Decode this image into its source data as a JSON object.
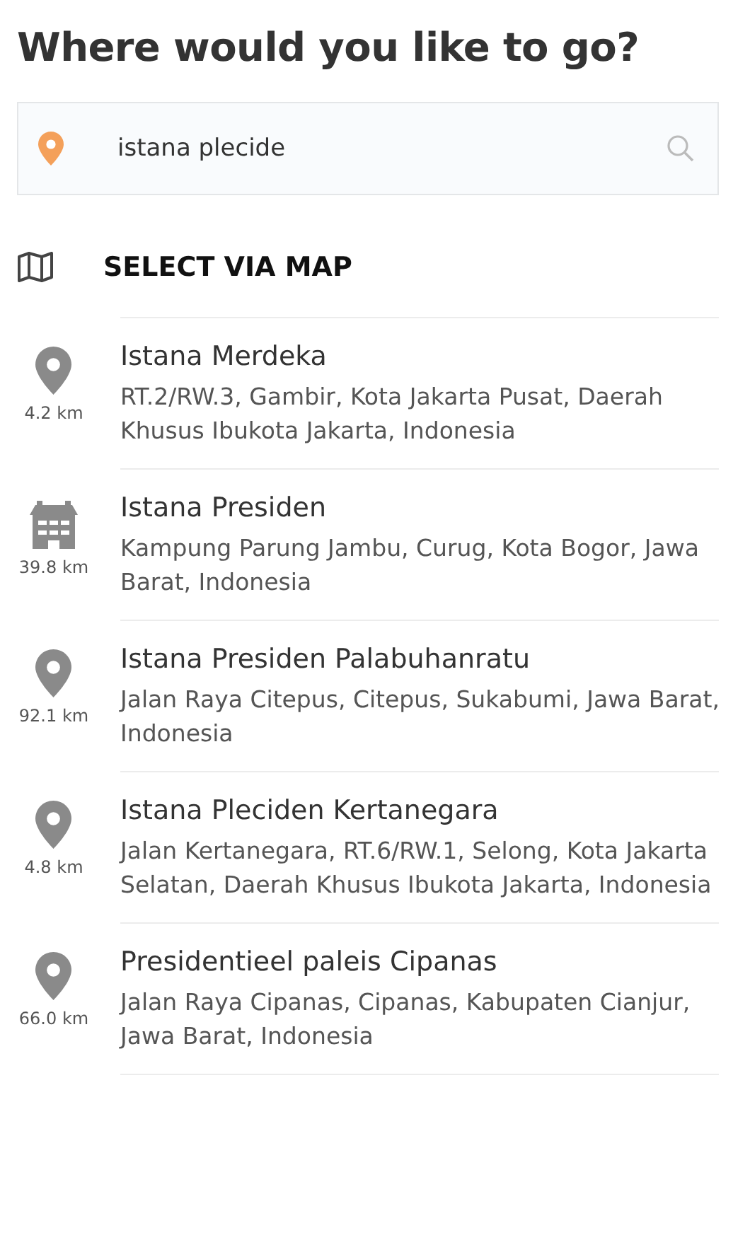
{
  "heading": "Where would you like to go?",
  "search": {
    "value": "istana plecide"
  },
  "map_option": {
    "label": "SELECT VIA MAP"
  },
  "results": [
    {
      "kind": "pin",
      "distance": "4.2 km",
      "name": "Istana Merdeka",
      "address": "RT.2/RW.3, Gambir, Kota Jakarta Pusat, Daerah Khusus Ibukota Jakarta, Indonesia"
    },
    {
      "kind": "building",
      "distance": "39.8 km",
      "name": "Istana Presiden",
      "address": "Kampung Parung Jambu, Curug, Kota Bogor, Jawa Barat, Indonesia"
    },
    {
      "kind": "pin",
      "distance": "92.1 km",
      "name": "Istana Presiden Palabuhanratu",
      "address": "Jalan Raya Citepus, Citepus, Sukabumi, Jawa Barat, Indonesia"
    },
    {
      "kind": "pin",
      "distance": "4.8 km",
      "name": "Istana Pleciden Kertanegara",
      "address": "Jalan Kertanegara, RT.6/RW.1, Selong, Kota Jakarta Selatan, Daerah Khusus Ibukota Jakarta, Indonesia"
    },
    {
      "kind": "pin",
      "distance": "66.0 km",
      "name": "Presidentieel paleis Cipanas",
      "address": "Jalan Raya Cipanas, Cipanas, Kabupaten Cianjur, Jawa Barat, Indonesia"
    }
  ]
}
